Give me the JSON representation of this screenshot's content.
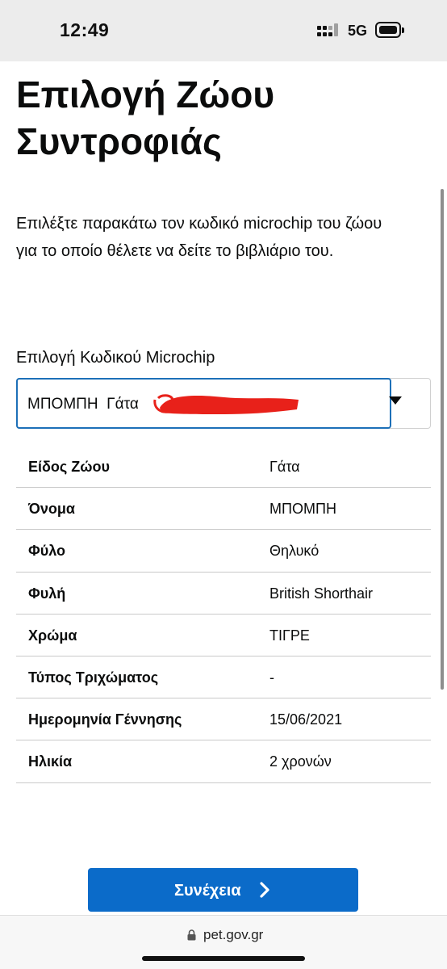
{
  "status_bar": {
    "time": "12:49",
    "network": "5G"
  },
  "page": {
    "title": "Επιλογή Ζώου Συντροφιάς",
    "intro": "Επιλέξτε παρακάτω τον κωδικό microchip του ζώου για το οποίο θέλετε να δείτε το βιβλιάριο του."
  },
  "microchip_select": {
    "label": "Επιλογή Κωδικού Microchip",
    "selected_value": "ΜΠΟΜΠΗ  Γάτα"
  },
  "details": {
    "rows": [
      {
        "label": "Είδος Ζώου",
        "value": "Γάτα"
      },
      {
        "label": "Όνομα",
        "value": "ΜΠΟΜΠΗ"
      },
      {
        "label": "Φύλο",
        "value": "Θηλυκό"
      },
      {
        "label": "Φυλή",
        "value": "British Shorthair"
      },
      {
        "label": "Χρώμα",
        "value": "ΤΙΓΡΕ"
      },
      {
        "label": "Τύπος Τριχώματος",
        "value": "-"
      },
      {
        "label": "Ημερομηνία Γέννησης",
        "value": "15/06/2021"
      },
      {
        "label": "Ηλικία",
        "value": "2 χρονών"
      }
    ]
  },
  "actions": {
    "continue_label": "Συνέχεια"
  },
  "browser": {
    "url": "pet.gov.gr"
  },
  "colors": {
    "primary_button": "#0b6bc9",
    "focus_border": "#1d70b8",
    "redaction": "#e8211a"
  },
  "icons": [
    "signal-icon",
    "battery-icon",
    "chevron-down-icon",
    "chevron-right-icon",
    "lock-icon"
  ]
}
